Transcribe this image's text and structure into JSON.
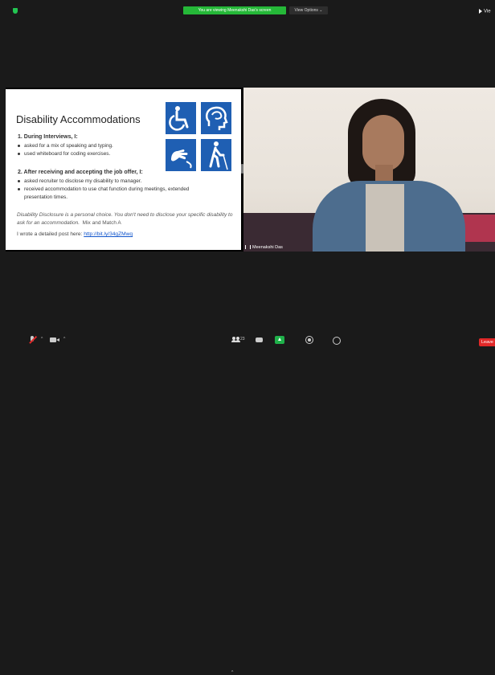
{
  "top": {
    "viewing_banner": "You are viewing Meenakshi Das's screen",
    "view_options": "View Options ⌄",
    "view_button": "Vie"
  },
  "slide": {
    "title": "Disability Accommodations",
    "section1": "1.  During Interviews, I:",
    "section1_bullets": [
      "asked for a mix of speaking and typing.",
      "used whiteboard for coding exercises."
    ],
    "section2": "2.  After receiving and accepting the job offer, I:",
    "section2_bullets": [
      "asked recruiter to disclose my disability to manager.",
      "received accommodation to use chat function during meetings, extended",
      "presentation times."
    ],
    "note": "Disability Disclosure is a personal choice. You don't need to disclose your specific disability to ask for an accommodation.",
    "note_tail": "Mix and Match A",
    "post_prefix": "I wrote a detailed post here: ",
    "post_link": "http://bit.ly/34gZMwq",
    "icons": [
      "wheelchair-icon",
      "cognitive-head-icon",
      "sign-language-icon",
      "blind-cane-icon"
    ]
  },
  "video": {
    "participant_name": "Meenakshi Das"
  },
  "toolbar": {
    "caret": "^",
    "participants_count": "23",
    "leave_label": "Leave"
  },
  "colors": {
    "banner_green": "#25b838",
    "leave_red": "#e02828",
    "icon_blue": "#1f5fb3",
    "link_blue": "#1155cc"
  }
}
